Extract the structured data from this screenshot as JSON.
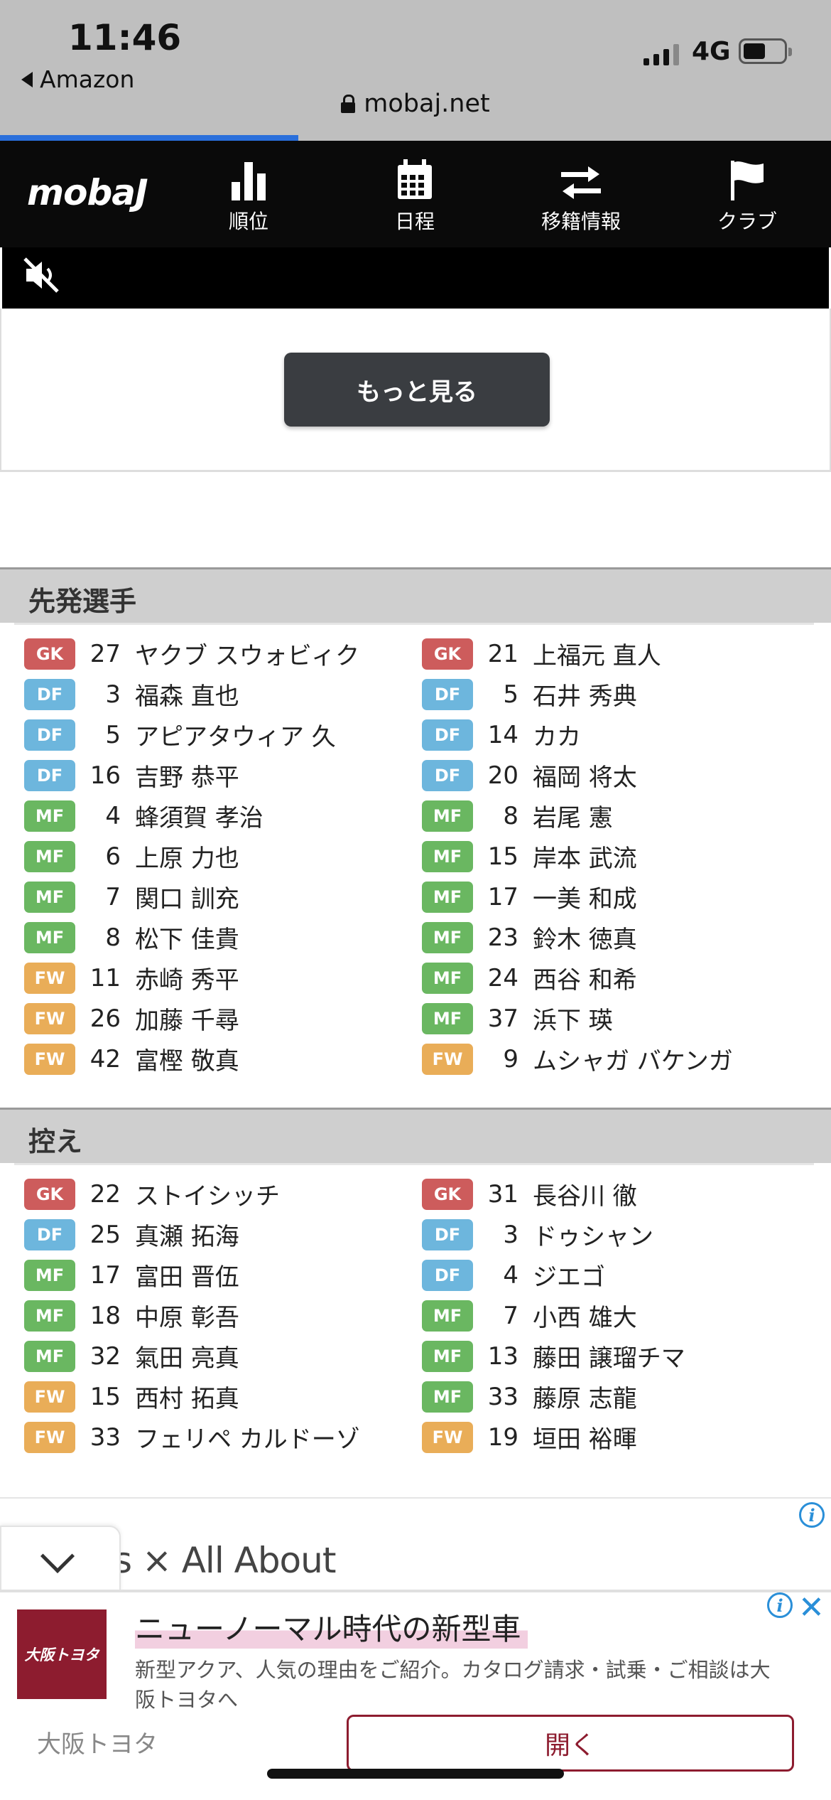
{
  "status": {
    "time": "11:46",
    "back_app": "Amazon",
    "network": "4G",
    "url": "mobaj.net"
  },
  "header": {
    "logo": "mobaJ",
    "nav": [
      {
        "label": "順位",
        "icon": "bar-chart-icon"
      },
      {
        "label": "日程",
        "icon": "calendar-icon"
      },
      {
        "label": "移籍情報",
        "icon": "transfer-arrows-icon"
      },
      {
        "label": "クラブ",
        "icon": "flag-icon"
      }
    ]
  },
  "video": {
    "mute_icon": "speaker-muted-icon"
  },
  "more_button": "もっと見る",
  "starters": {
    "title": "先発選手",
    "home": [
      {
        "pos": "GK",
        "num": "27",
        "name": "ヤクブ スウォビィク"
      },
      {
        "pos": "DF",
        "num": "3",
        "name": "福森 直也"
      },
      {
        "pos": "DF",
        "num": "5",
        "name": "アピアタウィア 久"
      },
      {
        "pos": "DF",
        "num": "16",
        "name": "吉野 恭平"
      },
      {
        "pos": "MF",
        "num": "4",
        "name": "蜂須賀 孝治"
      },
      {
        "pos": "MF",
        "num": "6",
        "name": "上原 力也"
      },
      {
        "pos": "MF",
        "num": "7",
        "name": "関口 訓充"
      },
      {
        "pos": "MF",
        "num": "8",
        "name": "松下 佳貴"
      },
      {
        "pos": "FW",
        "num": "11",
        "name": "赤崎 秀平"
      },
      {
        "pos": "FW",
        "num": "26",
        "name": "加藤 千尋"
      },
      {
        "pos": "FW",
        "num": "42",
        "name": "富樫 敬真"
      }
    ],
    "away": [
      {
        "pos": "GK",
        "num": "21",
        "name": "上福元 直人"
      },
      {
        "pos": "DF",
        "num": "5",
        "name": "石井 秀典"
      },
      {
        "pos": "DF",
        "num": "14",
        "name": "カカ"
      },
      {
        "pos": "DF",
        "num": "20",
        "name": "福岡 将太"
      },
      {
        "pos": "MF",
        "num": "8",
        "name": "岩尾 憲"
      },
      {
        "pos": "MF",
        "num": "15",
        "name": "岸本 武流"
      },
      {
        "pos": "MF",
        "num": "17",
        "name": "一美 和成"
      },
      {
        "pos": "MF",
        "num": "23",
        "name": "鈴木 徳真"
      },
      {
        "pos": "MF",
        "num": "24",
        "name": "西谷 和希"
      },
      {
        "pos": "MF",
        "num": "37",
        "name": "浜下 瑛"
      },
      {
        "pos": "FW",
        "num": "9",
        "name": "ムシャガ バケンガ"
      }
    ]
  },
  "subs": {
    "title": "控え",
    "home": [
      {
        "pos": "GK",
        "num": "22",
        "name": "ストイシッチ"
      },
      {
        "pos": "DF",
        "num": "25",
        "name": "真瀬 拓海"
      },
      {
        "pos": "MF",
        "num": "17",
        "name": "富田 晋伍"
      },
      {
        "pos": "MF",
        "num": "18",
        "name": "中原 彰吾"
      },
      {
        "pos": "MF",
        "num": "32",
        "name": "氣田 亮真"
      },
      {
        "pos": "FW",
        "num": "15",
        "name": "西村 拓真"
      },
      {
        "pos": "FW",
        "num": "33",
        "name": "フェリペ カルドーゾ"
      }
    ],
    "away": [
      {
        "pos": "GK",
        "num": "31",
        "name": "長谷川 徹"
      },
      {
        "pos": "DF",
        "num": "3",
        "name": "ドゥシャン"
      },
      {
        "pos": "DF",
        "num": "4",
        "name": "ジエゴ"
      },
      {
        "pos": "MF",
        "num": "7",
        "name": "小西 雄大"
      },
      {
        "pos": "MF",
        "num": "13",
        "name": "藤田 譲瑠チマ"
      },
      {
        "pos": "MF",
        "num": "33",
        "name": "藤原 志龍"
      },
      {
        "pos": "FW",
        "num": "19",
        "name": "垣田 裕暉"
      }
    ]
  },
  "ad_strip": {
    "text": "s × All About"
  },
  "ad": {
    "logo_text": "大阪トヨタ",
    "title": "ニューノーマル時代の新型車",
    "body": "新型アクア、人気の理由をご紹介。カタログ請求・試乗・ご相談は大阪トヨタへ",
    "source": "大阪トヨタ",
    "open_label": "開く",
    "close_glyph": "✕",
    "info_glyph": "i"
  },
  "colors": {
    "GK": "#cd5c5c",
    "DF": "#6db6dd",
    "MF": "#6ab761",
    "FW": "#e9ad58",
    "ad_brand": "#8d1c2f"
  }
}
